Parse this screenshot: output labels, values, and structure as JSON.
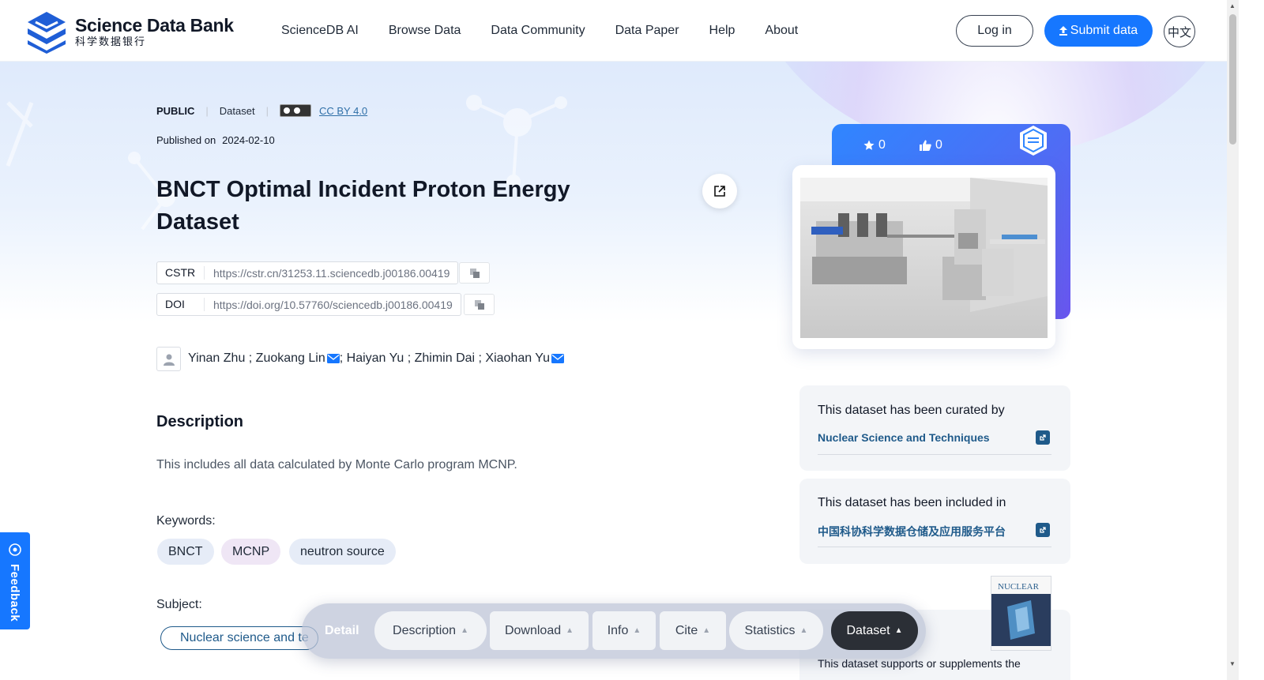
{
  "header": {
    "logo_en": "Science Data Bank",
    "logo_cn": "科学数据银行",
    "nav": [
      "ScienceDB AI",
      "Browse Data",
      "Data Community",
      "Data Paper",
      "Help",
      "About"
    ],
    "login_label": "Log in",
    "submit_label": "Submit data",
    "lang_label": "中文"
  },
  "dataset": {
    "visibility": "PUBLIC",
    "type": "Dataset",
    "license": "CC BY 4.0",
    "published_label": "Published on",
    "published_date": "2024-02-10",
    "title": "BNCT Optimal Incident Proton Energy Dataset",
    "identifiers": [
      {
        "label": "CSTR",
        "value": "https://cstr.cn/31253.11.sciencedb.j00186.00419"
      },
      {
        "label": "DOI",
        "value": "https://doi.org/10.57760/sciencedb.j00186.00419"
      }
    ],
    "authors": {
      "a1": "Yinan Zhu ; Zuokang Lin",
      "a2": "; Haiyan Yu ; Zhimin Dai ; Xiaohan Yu"
    },
    "description_title": "Description",
    "description": "This includes all data calculated by Monte Carlo program MCNP.",
    "keywords_label": "Keywords:",
    "keywords": [
      "BNCT",
      "MCNP",
      "neutron source"
    ],
    "subject_label": "Subject:",
    "subject": "Nuclear science and te"
  },
  "stats": {
    "stars": "0",
    "likes": "0"
  },
  "side": {
    "curated_title": "This dataset has been curated by",
    "curated_link": "Nuclear Science and Techniques",
    "included_title": "This dataset has been included in",
    "included_link": "中国科协科学数据仓储及应用服务平台",
    "supports_text": "This dataset supports or supplements the"
  },
  "journal": {
    "cover_title": "NUCLEAR"
  },
  "feedback_label": "Feedback",
  "tabbar": {
    "detail_label": "Detail",
    "tabs": [
      "Description",
      "Download",
      "Info",
      "Cite",
      "Statistics",
      "Dataset"
    ],
    "active": "Dataset"
  },
  "colors": {
    "primary": "#1677ff",
    "link": "#1f5a8a",
    "active_tab": "#2b2f36"
  }
}
